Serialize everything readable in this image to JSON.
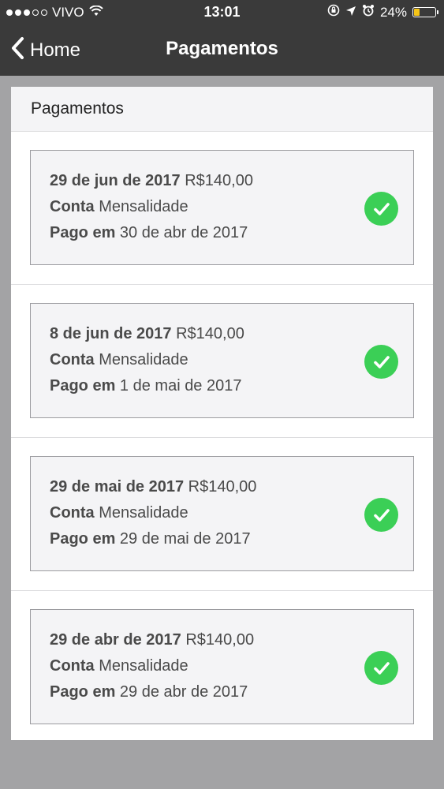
{
  "status_bar": {
    "carrier": "VIVO",
    "time": "13:01",
    "battery": "24%"
  },
  "nav": {
    "back_label": "Home",
    "title": "Pagamentos"
  },
  "panel": {
    "title": "Pagamentos"
  },
  "labels": {
    "conta": "Conta",
    "pago_em": "Pago em"
  },
  "payments": [
    {
      "date": "29 de jun de 2017",
      "amount": "R$140,00",
      "account": "Mensalidade",
      "paid_on": "30 de abr de 2017",
      "status_icon": "check-icon"
    },
    {
      "date": "8 de jun de 2017",
      "amount": "R$140,00",
      "account": "Mensalidade",
      "paid_on": "1 de mai de 2017",
      "status_icon": "check-icon"
    },
    {
      "date": "29 de mai de 2017",
      "amount": "R$140,00",
      "account": "Mensalidade",
      "paid_on": "29 de mai de 2017",
      "status_icon": "check-icon"
    },
    {
      "date": "29 de abr de 2017",
      "amount": "R$140,00",
      "account": "Mensalidade",
      "paid_on": "29 de abr de 2017",
      "status_icon": "check-icon"
    }
  ],
  "colors": {
    "nav_background": "#3a3a3a",
    "check_green": "#3bcf56",
    "page_background": "#a3a3a5"
  }
}
